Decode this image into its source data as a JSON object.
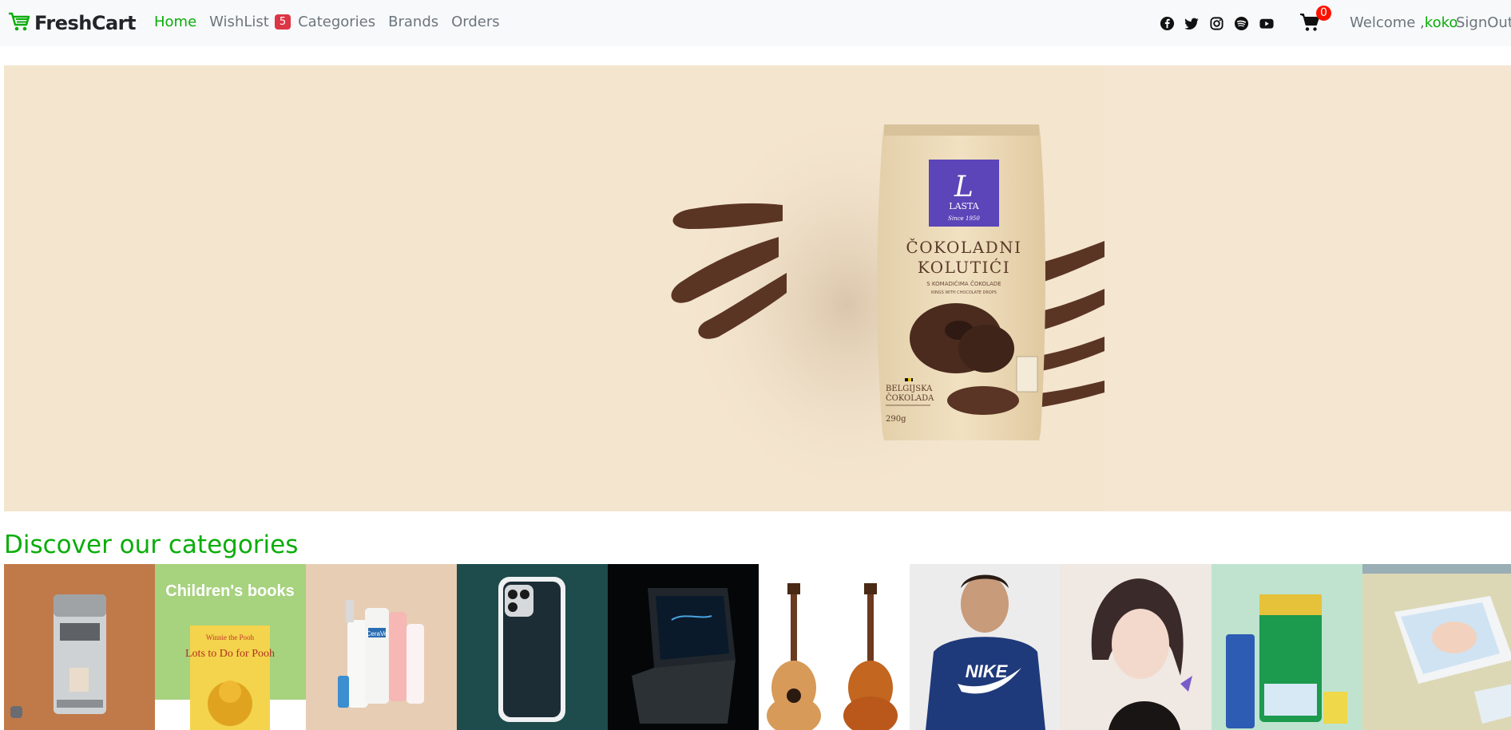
{
  "brand": {
    "name": "FreshCart",
    "logo_icon": "cart-logo-icon"
  },
  "nav": {
    "links": [
      {
        "label": "Home",
        "active": true
      },
      {
        "label": "WishList",
        "active": false
      },
      {
        "label": "Categories",
        "active": false
      },
      {
        "label": "Brands",
        "active": false
      },
      {
        "label": "Orders",
        "active": false
      }
    ],
    "wishlist_count": "5"
  },
  "social": [
    "facebook-icon",
    "twitter-icon",
    "instagram-icon",
    "spotify-icon",
    "youtube-icon"
  ],
  "cart": {
    "count": "0",
    "icon": "shopping-cart-icon"
  },
  "user": {
    "welcome_prefix": "Welcome ,",
    "name": "koko",
    "signout": "SignOut"
  },
  "hero": {
    "product_brand": "LASTA",
    "product_tagline": "Since 1950",
    "product_name_line1": "ČOKOLADNI",
    "product_name_line2": "KOLUTIĆI",
    "product_sub1": "S KOMADIĆIMA ČOKOLADE",
    "product_sub2": "RINGS WITH CHOCOLATE DROPS",
    "product_origin_line1": "BELGIJSKA",
    "product_origin_line2": "ČOKOLADA",
    "product_weight": "290g"
  },
  "categories_section": {
    "title": "Discover our categories",
    "items": [
      {
        "name": "coffee-machine"
      },
      {
        "name": "childrens-books",
        "caption": "Children's books",
        "book_title1": "Winnie the Pooh",
        "book_title2": "Lots to Do for Pooh"
      },
      {
        "name": "skincare",
        "product_label": "CeraVe"
      },
      {
        "name": "smartphone"
      },
      {
        "name": "laptop"
      },
      {
        "name": "guitars"
      },
      {
        "name": "hoodie",
        "logo_text": "NIKE"
      },
      {
        "name": "illustration"
      },
      {
        "name": "grocery"
      },
      {
        "name": "baby-diapers"
      }
    ]
  },
  "colors": {
    "accent": "#0aad0a",
    "badge_red": "#dc3545",
    "cart_badge": "#ff1100",
    "hero_bg": "#f5e6d2"
  }
}
